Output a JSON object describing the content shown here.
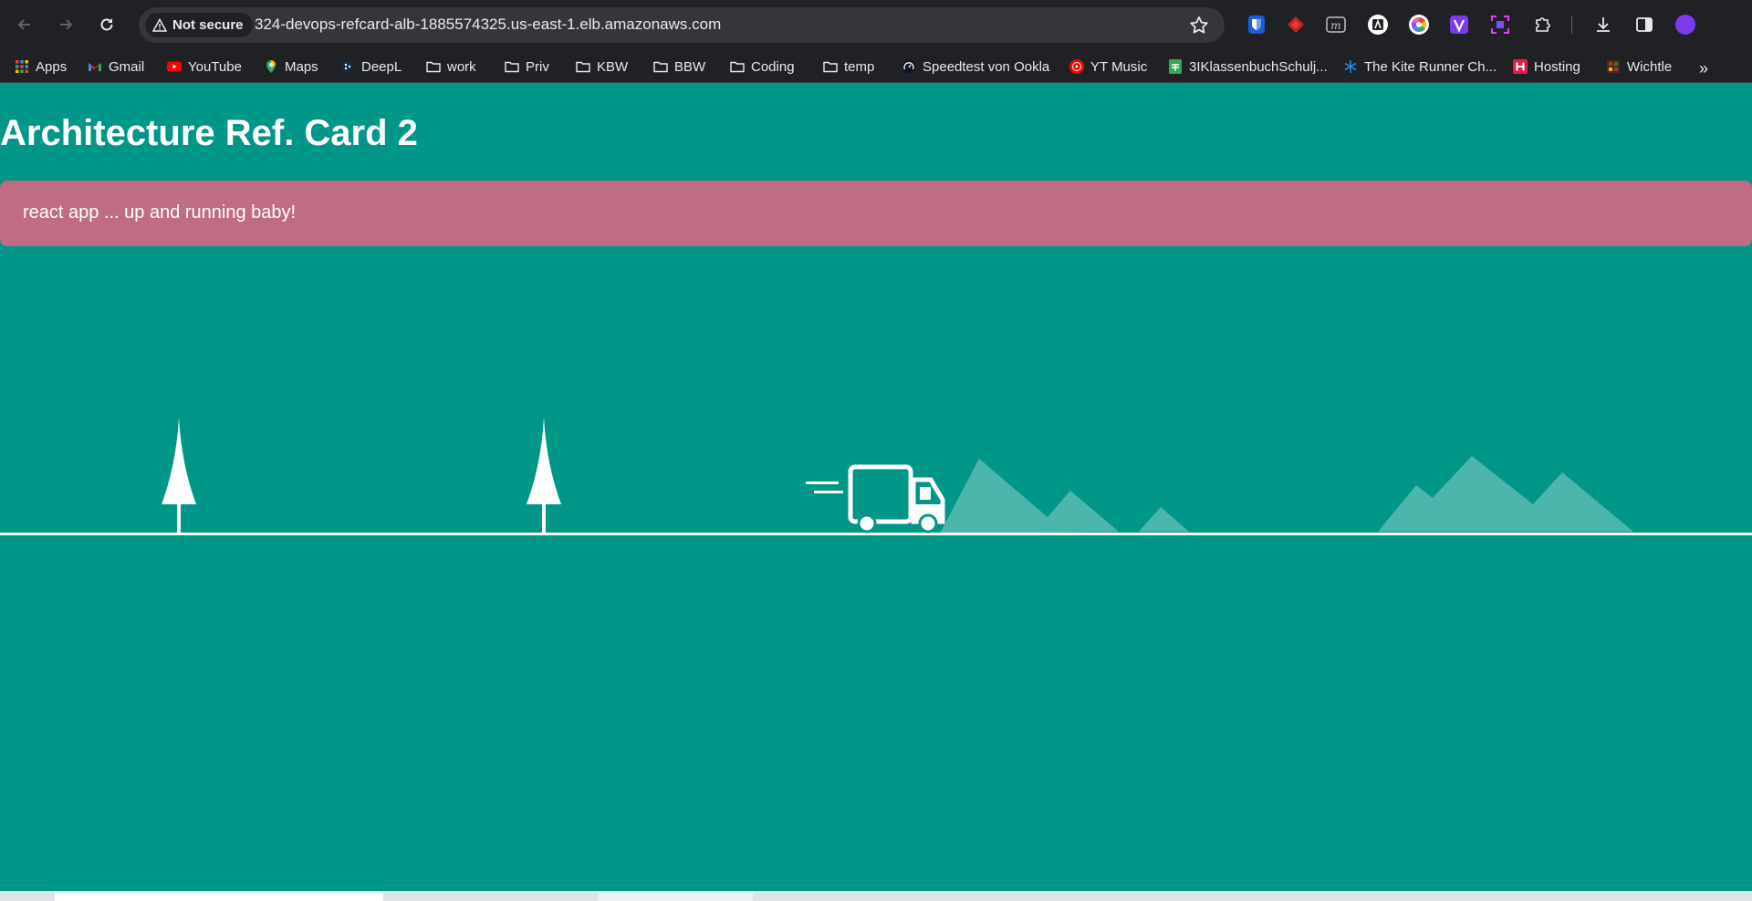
{
  "browser": {
    "security_label": "Not secure",
    "url": "324-devops-refcard-alb-1885574325.us-east-1.elb.amazonaws.com",
    "nav_icons": [
      "back-icon",
      "forward-icon",
      "reload-icon"
    ],
    "extensions": [
      "bitwarden-icon",
      "red-diamond-extension-icon",
      "m-extension-icon",
      "a-extension-icon",
      "color-wheel-extension-icon",
      "v-extension-icon",
      "frame-extension-icon",
      "puzzle-icon",
      "download-icon",
      "side-panel-icon",
      "profile-avatar-icon"
    ]
  },
  "bookmarks": [
    {
      "label": "Apps",
      "icon": "apps-grid-icon"
    },
    {
      "label": "Gmail",
      "icon": "gmail-icon"
    },
    {
      "label": "YouTube",
      "icon": "youtube-icon"
    },
    {
      "label": "Maps",
      "icon": "maps-pin-icon"
    },
    {
      "label": "DeepL",
      "icon": "deepl-icon"
    },
    {
      "label": "work",
      "icon": "folder-icon"
    },
    {
      "label": "Priv",
      "icon": "folder-icon"
    },
    {
      "label": "KBW",
      "icon": "folder-icon"
    },
    {
      "label": "BBW",
      "icon": "folder-icon"
    },
    {
      "label": "Coding",
      "icon": "folder-icon"
    },
    {
      "label": "temp",
      "icon": "folder-icon"
    },
    {
      "label": "Speedtest von Ookla",
      "icon": "speedtest-icon"
    },
    {
      "label": "YT Music",
      "icon": "yt-music-icon"
    },
    {
      "label": "3IKlassenbuchSchulj...",
      "icon": "sheets-icon"
    },
    {
      "label": "The Kite Runner Ch...",
      "icon": "snowflake-icon"
    },
    {
      "label": "Hosting",
      "icon": "hosting-icon"
    },
    {
      "label": "Wichtle",
      "icon": "wichtle-icon"
    }
  ],
  "page": {
    "title": "Architecture Ref. Card 2",
    "alert_text": "react app ... up and running baby!"
  },
  "colors": {
    "background": "#009688",
    "alert": "#c06c84",
    "chrome": "#202124",
    "mountains": "#4db6ac"
  }
}
